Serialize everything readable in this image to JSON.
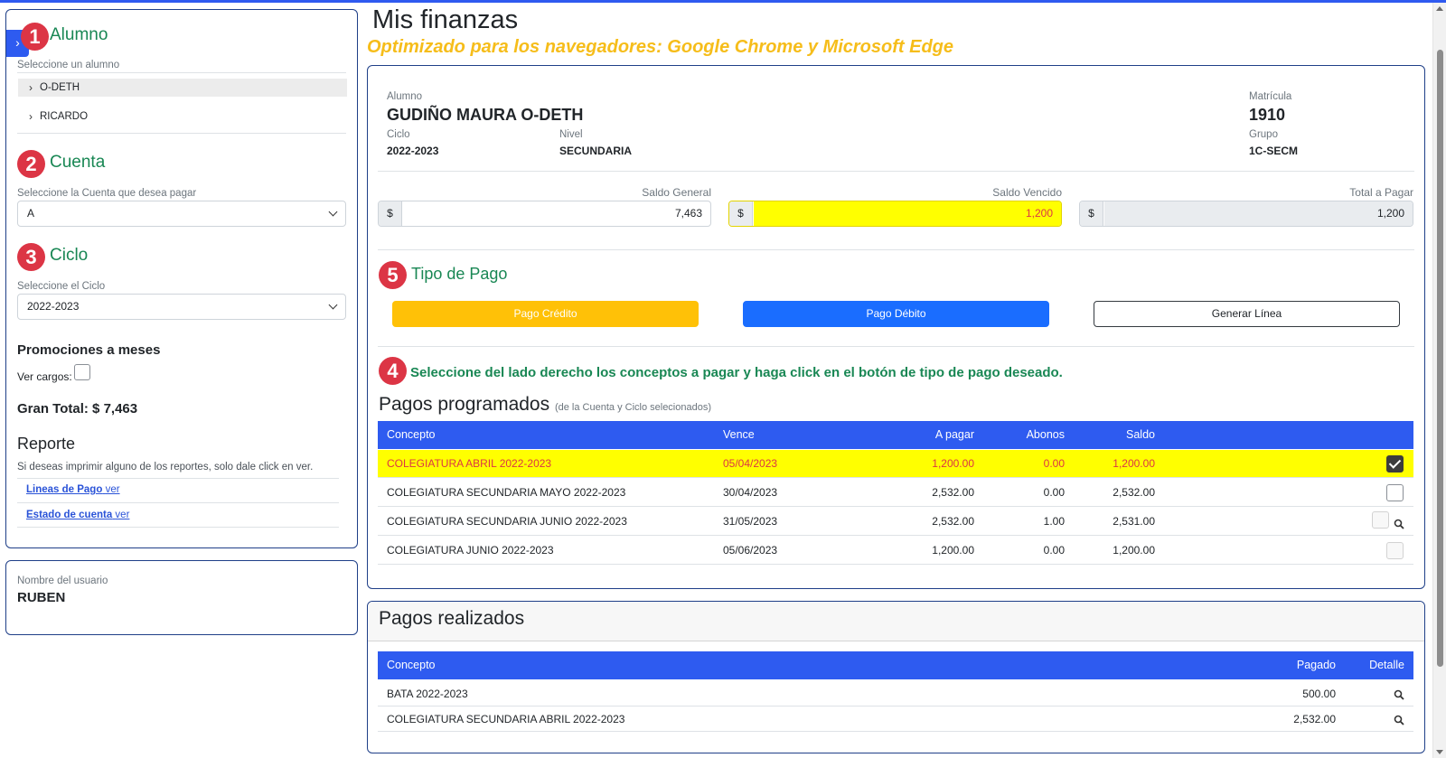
{
  "sidebar": {
    "sections": {
      "alumno": {
        "number": "1",
        "title": "Alumno",
        "subtitle": "Seleccione un alumno"
      },
      "cuenta": {
        "number": "2",
        "title": "Cuenta",
        "subtitle": "Seleccione la Cuenta que desea pagar",
        "selected": "A"
      },
      "ciclo": {
        "number": "3",
        "title": "Ciclo",
        "subtitle": "Seleccione el Ciclo",
        "selected": "2022-2023"
      }
    },
    "students": [
      {
        "name": "O-DETH",
        "active": true
      },
      {
        "name": "RICARDO",
        "active": false
      }
    ],
    "promociones": {
      "title": "Promociones a meses",
      "ver_cargos_label": "Ver cargos:"
    },
    "gran_total": "Gran Total: $ 7,463",
    "reporte": {
      "title": "Reporte",
      "description": "Si deseas imprimir alguno de los reportes, solo dale click en ver.",
      "links": [
        {
          "label": "Lineas de Pago",
          "action": "ver"
        },
        {
          "label": "Estado de cuenta",
          "action": "ver"
        }
      ]
    },
    "toggle_icon": "chevron-right-icon"
  },
  "user": {
    "label": "Nombre del usuario",
    "name": "RUBEN"
  },
  "main": {
    "title": "Mis finanzas",
    "optimized_notice": "Optimizado para los navegadores: Google Chrome y Microsoft Edge",
    "student": {
      "alumno_label": "Alumno",
      "alumno": "GUDIÑO MAURA O-DETH",
      "ciclo_label": "Ciclo",
      "ciclo": "2022-2023",
      "nivel_label": "Nivel",
      "nivel": "SECUNDARIA",
      "matricula_label": "Matrícula",
      "matricula": "1910",
      "grupo_label": "Grupo",
      "grupo": "1C-SECM"
    },
    "balances": {
      "currency": "$",
      "saldo_general_label": "Saldo General",
      "saldo_general": "7,463",
      "saldo_vencido_label": "Saldo Vencido",
      "saldo_vencido": "1,200",
      "total_pagar_label": "Total a Pagar",
      "total_pagar": "1,200"
    },
    "tipo_pago": {
      "number": "5",
      "title": "Tipo de Pago",
      "credito": "Pago Crédito",
      "debito": "Pago Débito",
      "linea": "Generar Línea"
    },
    "instruction": {
      "number": "4",
      "text": "Seleccione del lado derecho los conceptos a pagar y haga click en el botón de tipo de pago deseado."
    },
    "pagos_programados": {
      "title": "Pagos programados",
      "subtitle": "(de la Cuenta y Ciclo selecionados)",
      "columns": [
        "Concepto",
        "Vence",
        "A pagar",
        "Abonos",
        "Saldo"
      ],
      "rows": [
        {
          "concepto": "COLEGIATURA ABRIL 2022-2023",
          "vence": "05/04/2023",
          "a_pagar": "1,200.00",
          "abonos": "0.00",
          "saldo": "1,200.00",
          "checked": true,
          "highlight": true
        },
        {
          "concepto": "COLEGIATURA SECUNDARIA MAYO 2022-2023",
          "vence": "30/04/2023",
          "a_pagar": "2,532.00",
          "abonos": "0.00",
          "saldo": "2,532.00",
          "checked": false
        },
        {
          "concepto": "COLEGIATURA SECUNDARIA JUNIO 2022-2023",
          "vence": "31/05/2023",
          "a_pagar": "2,532.00",
          "abonos": "1.00",
          "saldo": "2,531.00",
          "checked": false,
          "disabled": true,
          "detail": true
        },
        {
          "concepto": "COLEGIATURA JUNIO 2022-2023",
          "vence": "05/06/2023",
          "a_pagar": "1,200.00",
          "abonos": "0.00",
          "saldo": "1,200.00",
          "checked": false,
          "disabled": true
        }
      ]
    },
    "pagos_realizados": {
      "title": "Pagos realizados",
      "columns": [
        "Concepto",
        "Pagado",
        "Detalle"
      ],
      "rows": [
        {
          "concepto": "BATA 2022-2023",
          "pagado": "500.00"
        },
        {
          "concepto": "COLEGIATURA SECUNDARIA ABRIL 2022-2023",
          "pagado": "2,532.00"
        }
      ]
    },
    "colors": {
      "accent": "#2e5bf0",
      "section_green": "#198754",
      "badge_red": "#dc3545",
      "credit_yellow": "#ffc107",
      "notice_yellow": "#f6bd1a",
      "highlight": "#ffff00"
    }
  }
}
